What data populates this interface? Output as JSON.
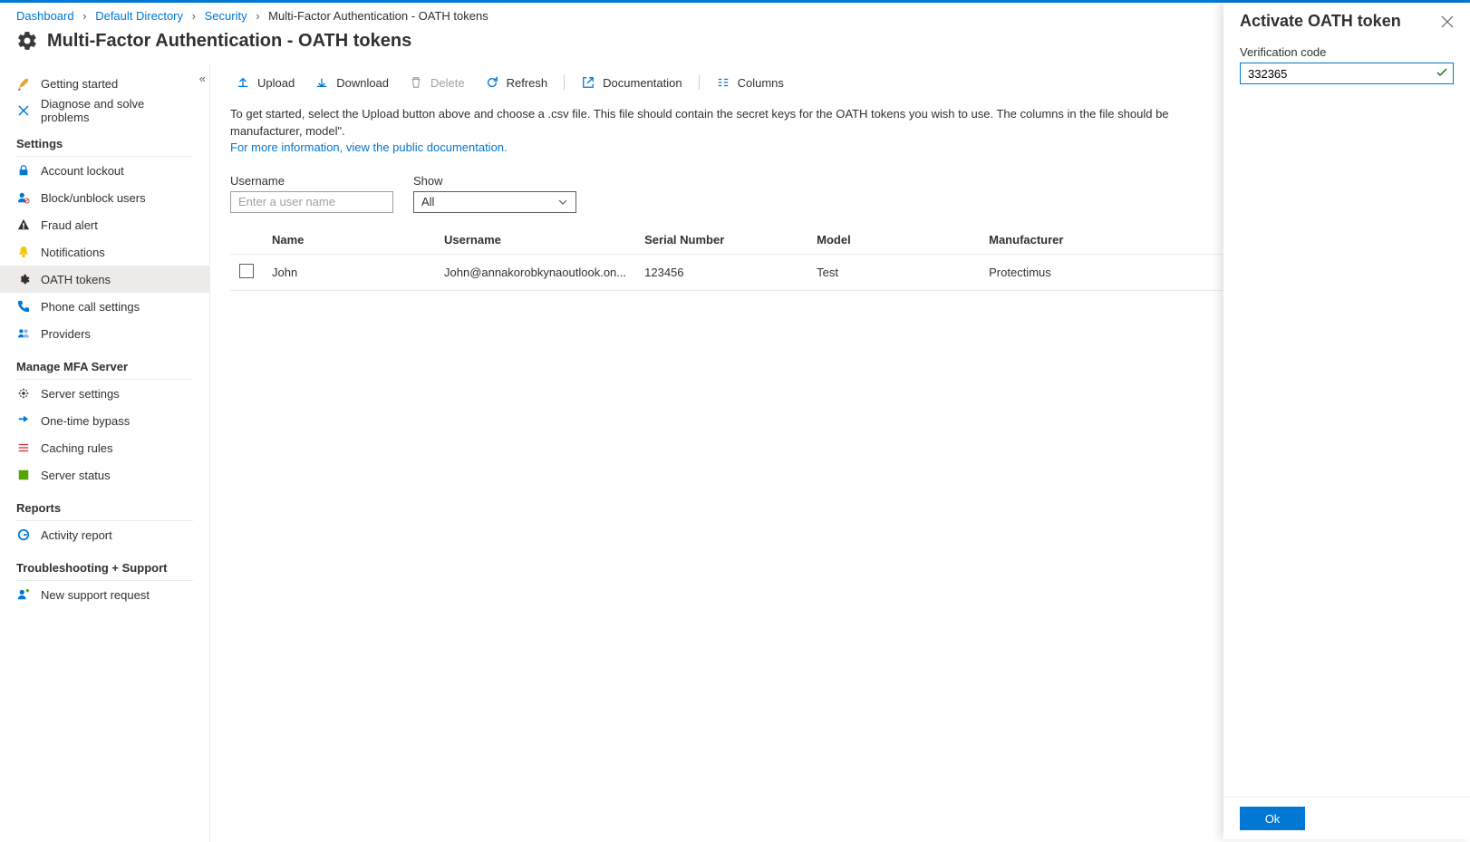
{
  "breadcrumbs": {
    "items": [
      "Dashboard",
      "Default Directory",
      "Security",
      "Multi-Factor Authentication - OATH tokens"
    ]
  },
  "page_title": "Multi-Factor Authentication - OATH tokens",
  "sidebar": {
    "top": [
      {
        "label": "Getting started",
        "icon": "rocket"
      },
      {
        "label": "Diagnose and solve problems",
        "icon": "diagnose"
      }
    ],
    "settings_heading": "Settings",
    "settings": [
      {
        "label": "Account lockout",
        "icon": "lock"
      },
      {
        "label": "Block/unblock users",
        "icon": "block"
      },
      {
        "label": "Fraud alert",
        "icon": "alert"
      },
      {
        "label": "Notifications",
        "icon": "bell"
      },
      {
        "label": "OATH tokens",
        "icon": "gear",
        "active": true
      },
      {
        "label": "Phone call settings",
        "icon": "phone"
      },
      {
        "label": "Providers",
        "icon": "providers"
      }
    ],
    "mfa_heading": "Manage MFA Server",
    "mfa": [
      {
        "label": "Server settings",
        "icon": "gear"
      },
      {
        "label": "One-time bypass",
        "icon": "bypass"
      },
      {
        "label": "Caching rules",
        "icon": "cache"
      },
      {
        "label": "Server status",
        "icon": "status"
      }
    ],
    "reports_heading": "Reports",
    "reports": [
      {
        "label": "Activity report",
        "icon": "activity"
      }
    ],
    "support_heading": "Troubleshooting + Support",
    "support": [
      {
        "label": "New support request",
        "icon": "support"
      }
    ]
  },
  "toolbar": {
    "upload": "Upload",
    "download": "Download",
    "delete": "Delete",
    "refresh": "Refresh",
    "documentation": "Documentation",
    "columns": "Columns"
  },
  "info": {
    "text": "To get started, select the Upload button above and choose a .csv file. This file should contain the secret keys for the OATH tokens you wish to use. The columns in the file should be manufacturer, model\".",
    "link": "For more information, view the public documentation."
  },
  "filters": {
    "username_label": "Username",
    "username_placeholder": "Enter a user name",
    "show_label": "Show",
    "show_value": "All"
  },
  "table": {
    "headers": {
      "name": "Name",
      "username": "Username",
      "serial": "Serial Number",
      "model": "Model",
      "manufacturer": "Manufacturer"
    },
    "rows": [
      {
        "name": "John",
        "username": "John@annakorobkynaoutlook.on...",
        "serial": "123456",
        "model": "Test",
        "manufacturer": "Protectimus"
      }
    ]
  },
  "panel": {
    "title": "Activate OATH token",
    "verification_label": "Verification code",
    "verification_value": "332365",
    "ok": "Ok"
  }
}
